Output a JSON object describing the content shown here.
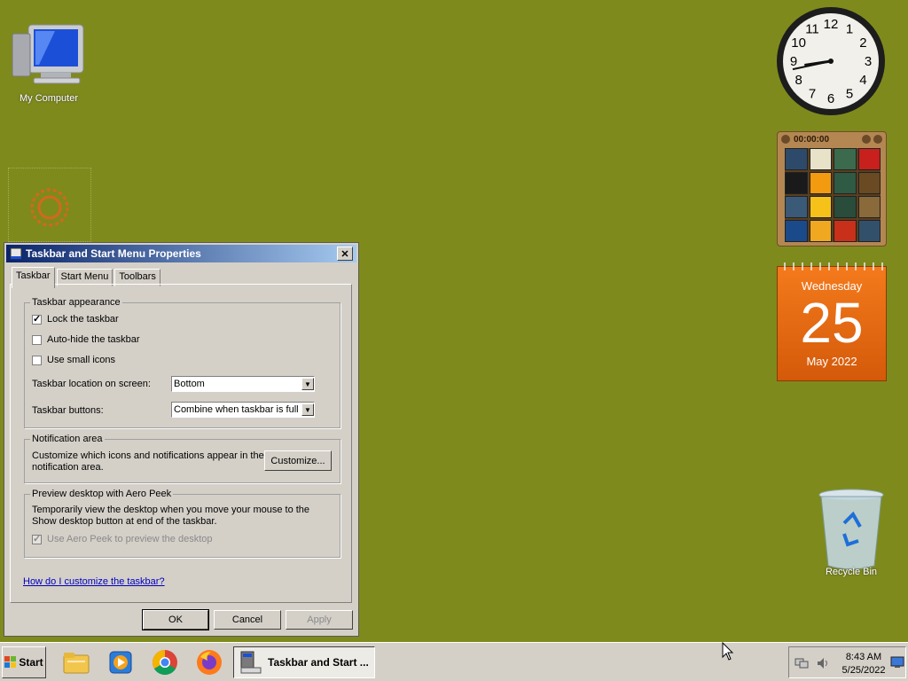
{
  "desktop": {
    "background": "#7f8a1c",
    "icons": [
      {
        "label": "My Computer",
        "icon": "computer-icon"
      },
      {
        "label": "Recycle Bin",
        "icon": "recycle-bin-icon"
      }
    ]
  },
  "gadgets": {
    "clock": {
      "numerals": [
        "12",
        "1",
        "2",
        "3",
        "4",
        "5",
        "6",
        "7",
        "8",
        "9",
        "10",
        "11"
      ],
      "time": "8:43"
    },
    "puzzle": {
      "timer": "00:00:00"
    },
    "calendar": {
      "weekday": "Wednesday",
      "day": "25",
      "month_year": "May 2022"
    }
  },
  "dialog": {
    "title": "Taskbar and Start Menu Properties",
    "tabs": [
      "Taskbar",
      "Start Menu",
      "Toolbars"
    ],
    "active_tab": "Taskbar",
    "appearance": {
      "legend": "Taskbar appearance",
      "lock": {
        "label": "Lock the taskbar",
        "checked": true
      },
      "autohide": {
        "label": "Auto-hide the taskbar",
        "checked": false
      },
      "small_icons": {
        "label": "Use small icons",
        "checked": false
      },
      "location_label": "Taskbar location on screen:",
      "location_value": "Bottom",
      "buttons_label": "Taskbar buttons:",
      "buttons_value": "Combine when taskbar is full"
    },
    "notification": {
      "legend": "Notification area",
      "text": "Customize which icons and notifications appear in the notification area.",
      "button": "Customize..."
    },
    "aero_peek": {
      "legend": "Preview desktop with Aero Peek",
      "text": "Temporarily view the desktop when you move your mouse to the Show desktop button at end of the taskbar.",
      "checkbox": {
        "label": "Use Aero Peek to preview the desktop",
        "checked": true,
        "disabled": true
      }
    },
    "help_link": "How do I customize the taskbar?",
    "buttons": {
      "ok": "OK",
      "cancel": "Cancel",
      "apply": "Apply"
    }
  },
  "taskbar": {
    "start_label": "Start",
    "pinned": [
      "folder-icon",
      "media-player-icon",
      "chrome-icon",
      "firefox-icon"
    ],
    "active_window": "Taskbar and Start ...",
    "tray": {
      "time": "8:43 AM",
      "date": "5/25/2022"
    }
  }
}
